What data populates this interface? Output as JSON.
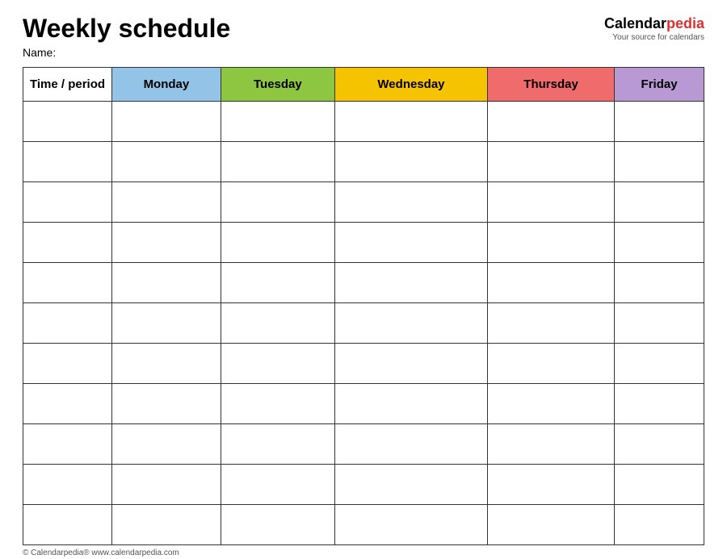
{
  "header": {
    "title": "Weekly schedule",
    "name_label": "Name:",
    "logo_calendar": "Calendar",
    "logo_pedia": "pedia",
    "logo_tagline": "Your source for calendars"
  },
  "table": {
    "columns": [
      {
        "id": "time",
        "label": "Time / period",
        "color_class": "col-time"
      },
      {
        "id": "monday",
        "label": "Monday",
        "color_class": "col-monday"
      },
      {
        "id": "tuesday",
        "label": "Tuesday",
        "color_class": "col-tuesday"
      },
      {
        "id": "wednesday",
        "label": "Wednesday",
        "color_class": "col-wednesday"
      },
      {
        "id": "thursday",
        "label": "Thursday",
        "color_class": "col-thursday"
      },
      {
        "id": "friday",
        "label": "Friday",
        "color_class": "col-friday"
      }
    ],
    "row_count": 11
  },
  "footer": {
    "text": "© Calendarpedia®  www.calendarpedia.com"
  }
}
